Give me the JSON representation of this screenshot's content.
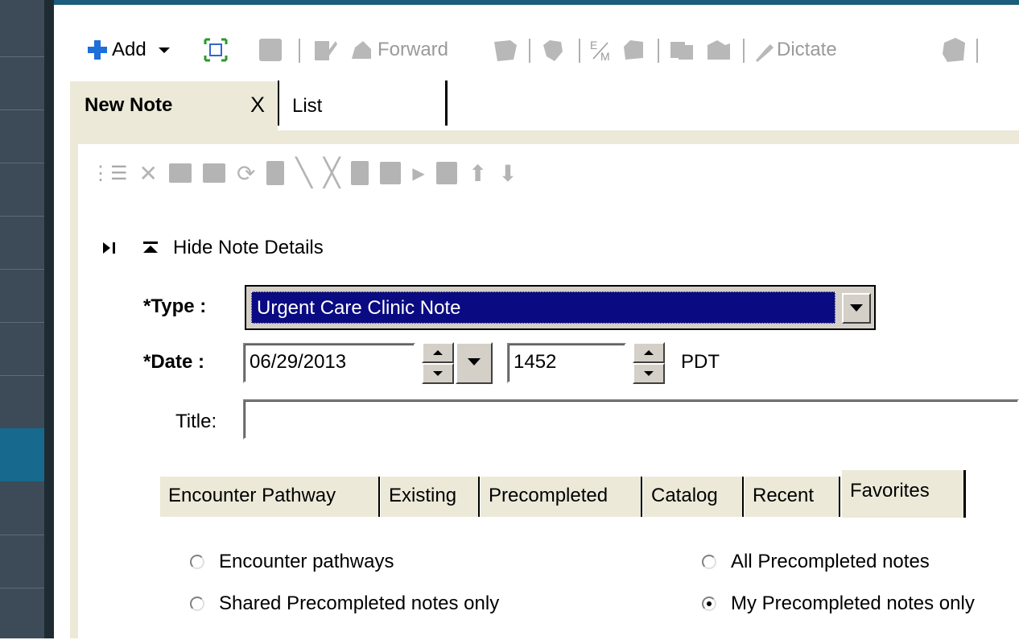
{
  "toolbar": {
    "add_label": "Add",
    "forward_label": "Forward",
    "dictate_label": "Dictate",
    "em_label": "E/M"
  },
  "tabs": {
    "new_note": "New Note",
    "close_symbol": "X",
    "list": "List"
  },
  "details": {
    "toggle_label": "Hide Note Details"
  },
  "form": {
    "type_label": "*Type :",
    "type_value": "Urgent Care Clinic Note",
    "date_label": "*Date :",
    "date_value": "06/29/2013",
    "time_value": "1452",
    "timezone": "PDT",
    "title_label": "Title:",
    "title_value": ""
  },
  "lower_tabs": [
    {
      "label": "Encounter Pathway",
      "selected": false
    },
    {
      "label": "Existing",
      "selected": false
    },
    {
      "label": "Precompleted",
      "selected": false
    },
    {
      "label": "Catalog",
      "selected": false
    },
    {
      "label": "Recent",
      "selected": false
    },
    {
      "label": "Favorites",
      "selected": true
    }
  ],
  "radios": {
    "encounter_pathways": {
      "label": "Encounter pathways",
      "checked": false
    },
    "all_precompleted": {
      "label": "All Precompleted notes",
      "checked": false
    },
    "shared_precompleted": {
      "label": "Shared Precompleted notes only",
      "checked": false
    },
    "my_precompleted": {
      "label": "My Precompleted notes only",
      "checked": true
    }
  },
  "colors": {
    "selection": "#0a0a82",
    "add_icon": "#1e6fd9",
    "rail": "#3c4b57",
    "rail_active": "#176a8e"
  }
}
